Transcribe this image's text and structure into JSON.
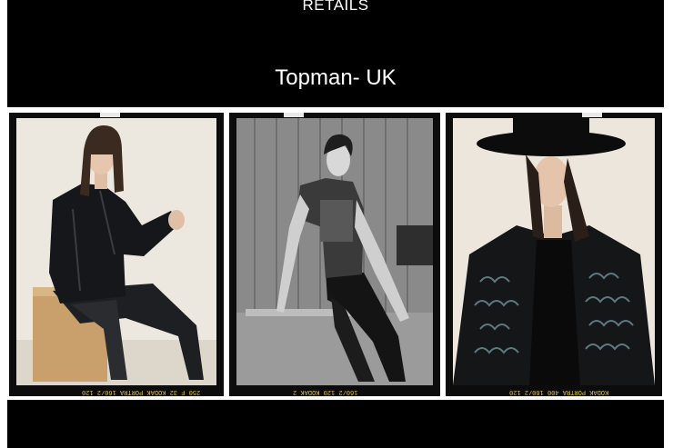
{
  "slide": {
    "section_label": "RETAILS",
    "retailer": "Topman- UK"
  },
  "photos": [
    {
      "name": "model-leather-jacket",
      "edge_text": "250 F 32 KODAK PORTRA 160/2 120"
    },
    {
      "name": "model-graphic-tee",
      "edge_text": "160/2 120 KODAK 2"
    },
    {
      "name": "model-hat-embellished-jacket",
      "edge_text": "KODAK PORTRA 400 160/2 120"
    }
  ],
  "colors": {
    "slide_bg": "#000000",
    "text": "#ffffff",
    "page_bg": "#ffffff",
    "film_border": "#0c0c0c",
    "film_edge_text": "#d8c25a"
  }
}
